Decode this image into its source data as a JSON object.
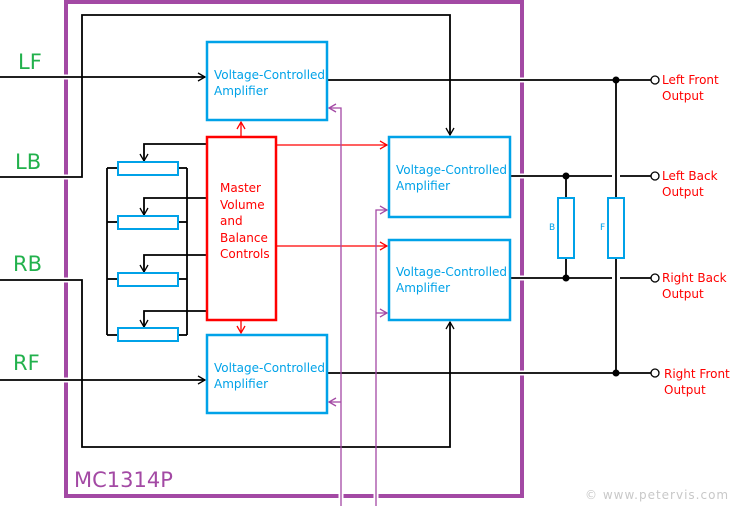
{
  "chip": {
    "label": "MC1314P"
  },
  "inputs": [
    "LF",
    "LB",
    "RB",
    "RF"
  ],
  "vca_label": [
    "Voltage-Controlled",
    "Amplifier"
  ],
  "master": [
    "Master",
    "Volume",
    "and",
    "Balance",
    "Controls"
  ],
  "outputs": [
    [
      "Left Front",
      "Output"
    ],
    [
      "Left Back",
      "Output"
    ],
    [
      "Right Back",
      "Output"
    ],
    [
      "Right Front",
      "Output"
    ]
  ],
  "resistors": {
    "b": "B",
    "f": "F"
  },
  "watermark": "© www.petervis.com",
  "colors": {
    "chip": "#a349a4",
    "vca": "#00a2e8",
    "master": "#ff0000",
    "inputs": "#22b14c",
    "wires": "#000000"
  }
}
